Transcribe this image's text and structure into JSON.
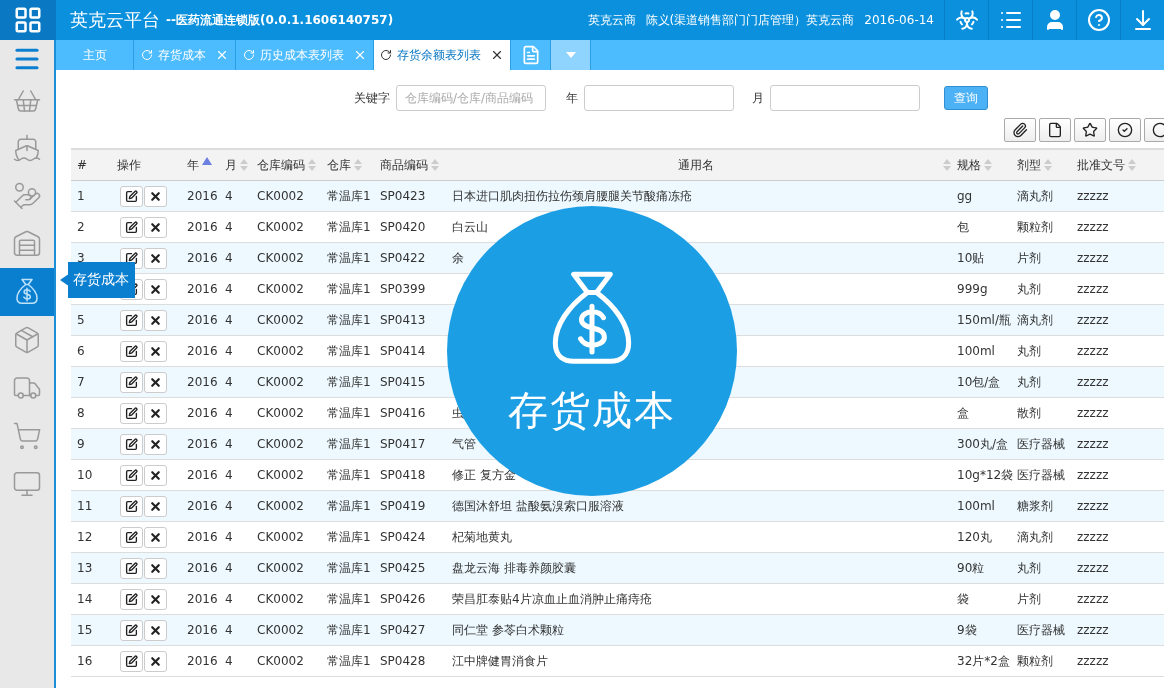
{
  "header": {
    "title": "英克云平台",
    "subtitle": "--医药流通连锁版(0.0.1.1606140757)",
    "company": "英克云商",
    "user": "陈义(渠道销售部门门店管理）英克云商",
    "date": "2016-06-14"
  },
  "sidebar": {
    "items": [
      {
        "selected": false
      },
      {
        "selected": false
      },
      {
        "selected": false
      },
      {
        "selected": false
      },
      {
        "selected": true
      },
      {
        "selected": false
      },
      {
        "selected": false
      },
      {
        "selected": false
      },
      {
        "selected": false
      }
    ],
    "tooltip": "存货成本"
  },
  "tabs": [
    {
      "kind": "home",
      "label": "主页",
      "selected": false
    },
    {
      "kind": "page",
      "label": "存货成本",
      "selected": false
    },
    {
      "kind": "page",
      "label": "历史成本表列表",
      "selected": false
    },
    {
      "kind": "page",
      "label": "存货余额表列表",
      "selected": true
    }
  ],
  "search": {
    "keyword_label": "关键字",
    "keyword_placeholder": "仓库编码/仓库/商品编码",
    "year_label": "年",
    "month_label": "月",
    "query_button": "查询"
  },
  "table": {
    "columns": [
      {
        "label": "#"
      },
      {
        "label": "操作"
      },
      {
        "label": "年",
        "sortable": true,
        "sorted_ascending": true
      },
      {
        "label": "月",
        "sortable": true,
        "sorted_ascending": false
      },
      {
        "label": "仓库编码",
        "sortable": true,
        "sorted_ascending": false
      },
      {
        "label": "仓库",
        "sortable": true,
        "sorted_ascending": false
      },
      {
        "label": "商品编码",
        "sortable": true,
        "sorted_ascending": false
      },
      {
        "label": "通用名",
        "sortable": true,
        "sorted_ascending": false
      },
      {
        "label": "规格",
        "sortable": true,
        "sorted_ascending": false
      },
      {
        "label": "剂型",
        "sortable": true,
        "sorted_ascending": false
      },
      {
        "label": "批准文号",
        "sortable": true,
        "sorted_ascending": false
      }
    ],
    "rows": [
      [
        "1",
        "",
        "2016",
        "4",
        "CK0002",
        "常温库1",
        "SP0423",
        "日本进口肌肉扭伤拉伤颈肩腰腿关节酸痛冻疮",
        "gg",
        "滴丸剂",
        "zzzzz"
      ],
      [
        "2",
        "",
        "2016",
        "4",
        "CK0002",
        "常温库1",
        "SP0420",
        "白云山",
        "包",
        "颗粒剂",
        "zzzzz"
      ],
      [
        "3",
        "",
        "2016",
        "4",
        "CK0002",
        "常温库1",
        "SP0422",
        "余",
        "10贴",
        "片剂",
        "zzzzz"
      ],
      [
        "",
        "",
        "2016",
        "4",
        "CK0002",
        "常温库1",
        "SP0399",
        "",
        "999g",
        "丸剂",
        "zzzzz"
      ],
      [
        "5",
        "",
        "2016",
        "4",
        "CK0002",
        "常温库1",
        "SP0413",
        "",
        "150ml/瓶",
        "滴丸剂",
        "zzzzz"
      ],
      [
        "6",
        "",
        "2016",
        "4",
        "CK0002",
        "常温库1",
        "SP0414",
        "",
        "100ml",
        "丸剂",
        "zzzzz"
      ],
      [
        "7",
        "",
        "2016",
        "4",
        "CK0002",
        "常温库1",
        "SP0415",
        "",
        "10包/盒",
        "丸剂",
        "zzzzz"
      ],
      [
        "8",
        "",
        "2016",
        "4",
        "CK0002",
        "常温库1",
        "SP0416",
        "虫",
        "盒",
        "散剂",
        "zzzzz"
      ],
      [
        "9",
        "",
        "2016",
        "4",
        "CK0002",
        "常温库1",
        "SP0417",
        "气管",
        "300丸/盒",
        "医疗器械",
        "zzzzz"
      ],
      [
        "10",
        "",
        "2016",
        "4",
        "CK0002",
        "常温库1",
        "SP0418",
        "修正 复方金",
        "10g*12袋",
        "医疗器械",
        "zzzzz"
      ],
      [
        "11",
        "",
        "2016",
        "4",
        "CK0002",
        "常温库1",
        "SP0419",
        "德国沐舒坦 盐酸氨溴索口服溶液",
        "100ml",
        "糖浆剂",
        "zzzzz"
      ],
      [
        "12",
        "",
        "2016",
        "4",
        "CK0002",
        "常温库1",
        "SP0424",
        "杞菊地黄丸",
        "120丸",
        "滴丸剂",
        "zzzzz"
      ],
      [
        "13",
        "",
        "2016",
        "4",
        "CK0002",
        "常温库1",
        "SP0425",
        "盘龙云海 排毒养颜胶囊",
        "90粒",
        "丸剂",
        "zzzzz"
      ],
      [
        "14",
        "",
        "2016",
        "4",
        "CK0002",
        "常温库1",
        "SP0426",
        "荣昌肛泰贴4片凉血止血消肿止痛痔疮",
        "袋",
        "片剂",
        "zzzzz"
      ],
      [
        "15",
        "",
        "2016",
        "4",
        "CK0002",
        "常温库1",
        "SP0427",
        "同仁堂 参苓白术颗粒",
        "9袋",
        "医疗器械",
        "zzzzz"
      ],
      [
        "16",
        "",
        "2016",
        "4",
        "CK0002",
        "常温库1",
        "SP0428",
        "江中牌健胃消食片",
        "32片*2盒",
        "颗粒剂",
        "zzzzz"
      ]
    ]
  },
  "overlay": {
    "label": "存货成本"
  }
}
